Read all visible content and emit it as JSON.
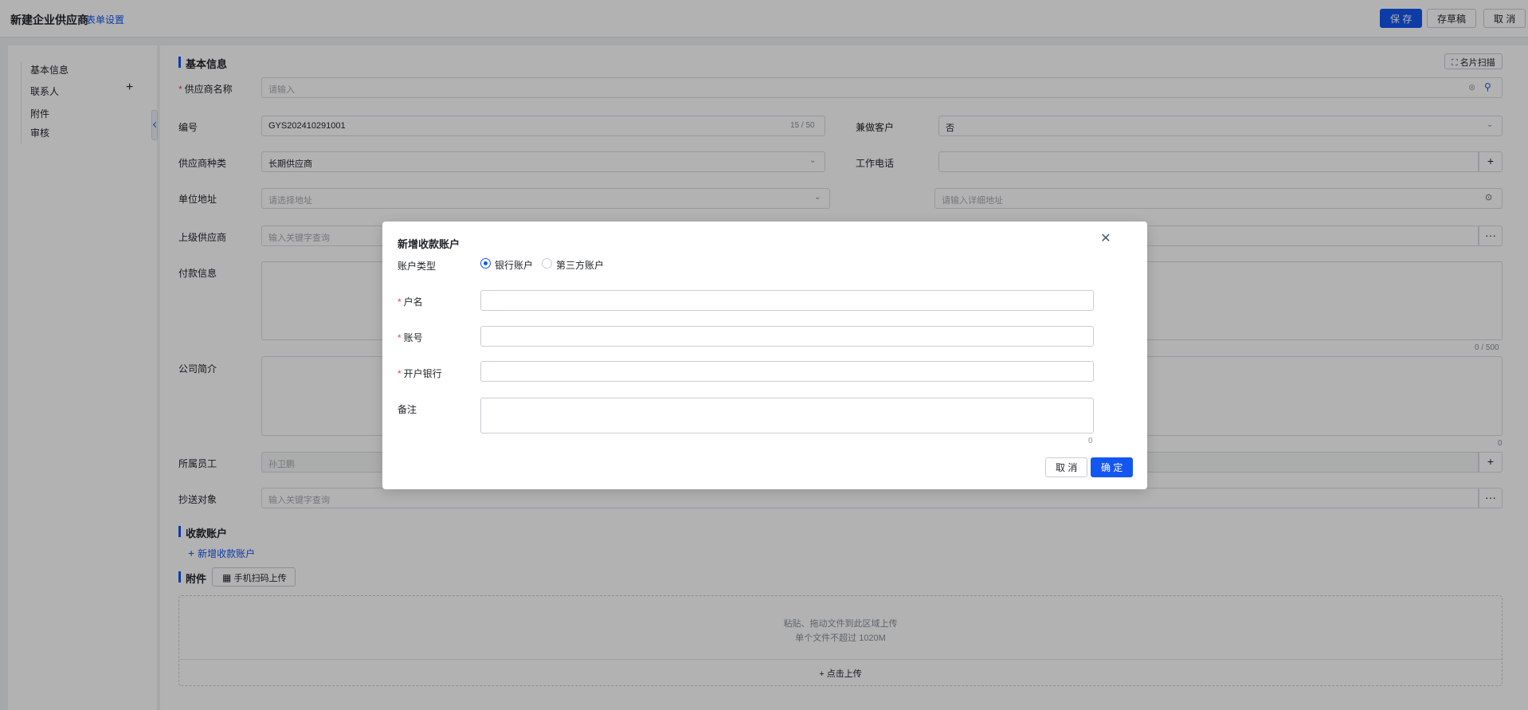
{
  "header": {
    "title": "新建企业供应商",
    "form_settings": "表单设置",
    "save": "保 存",
    "draft": "存草稿",
    "cancel": "取 消"
  },
  "sidebar": {
    "items": [
      "基本信息",
      "联系人",
      "附件",
      "审核"
    ],
    "add_icon": "plus-icon"
  },
  "basic": {
    "section_title": "基本信息",
    "scan_card": "名片扫描",
    "supplier_name_label": "供应商名称",
    "supplier_name_placeholder": "请输入",
    "code_label": "编号",
    "code_value": "GYS202410291001",
    "code_counter": "15 / 50",
    "also_customer_label": "兼做客户",
    "also_customer_value": "否",
    "supplier_type_label": "供应商种类",
    "supplier_type_value": "长期供应商",
    "work_phone_label": "工作电话",
    "address_label": "单位地址",
    "address_placeholder": "请选择地址",
    "detail_address_placeholder": "请输入详细地址",
    "parent_supplier_label": "上级供应商",
    "parent_supplier_placeholder": "输入关键字查询",
    "payment_info_label": "付款信息",
    "payment_counter": "0 / 500",
    "company_intro_label": "公司简介",
    "employee_label": "所属员工",
    "employee_value": "孙卫鹏",
    "cc_label": "抄送对象",
    "cc_placeholder": "输入关键字查询"
  },
  "accounts": {
    "section_title": "收款账户",
    "add_label": "新增收款账户"
  },
  "attachments": {
    "section_title": "附件",
    "mobile_upload": "手机扫码上传",
    "drop_hint": "粘贴、拖动文件到此区域上传",
    "size_hint": "单个文件不超过 1020M",
    "click_upload": "+ 点击上传"
  },
  "modal": {
    "title": "新增收款账户",
    "account_type_label": "账户类型",
    "radio_bank": "银行账户",
    "radio_third": "第三方账户",
    "selected": "bank",
    "holder_label": "户名",
    "account_no_label": "账号",
    "bank_label": "开户银行",
    "remark_label": "备注",
    "remark_counter": "0",
    "cancel": "取 消",
    "confirm": "确 定"
  },
  "colors": {
    "primary": "#1456f0",
    "required": "#f53f3f"
  }
}
